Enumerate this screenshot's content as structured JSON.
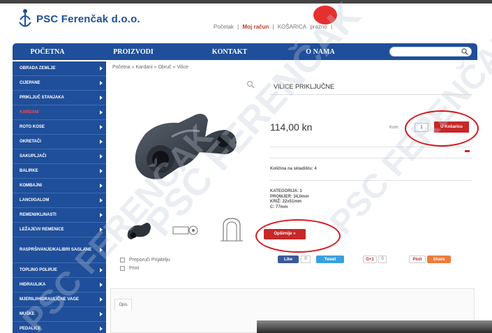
{
  "site": {
    "logo_text": "PSC Ferenčak d.o.o.",
    "top_links": [
      "Početak",
      "Moj račun",
      "KOŠARICA",
      "prazno"
    ],
    "separator": "|"
  },
  "nav": {
    "items": [
      "POČETNA",
      "PROIZVODI",
      "KONTAKT",
      "O NAMA"
    ],
    "search_placeholder": ""
  },
  "sidebar": {
    "items": [
      {
        "label": "OBRADA ZEMLJE",
        "active": false
      },
      {
        "label": "CIJEPANE",
        "active": false
      },
      {
        "label": "PRIKLJUČ STANJAKA",
        "active": false
      },
      {
        "label": "KARDANI",
        "active": true
      },
      {
        "label": "ROTO KOSE",
        "active": false
      },
      {
        "label": "OKRETAČI",
        "active": false
      },
      {
        "label": "SAKUPLJAČI",
        "active": false
      },
      {
        "label": "BALIRKE",
        "active": false
      },
      {
        "label": "KOMBAJNI",
        "active": false
      },
      {
        "label": "LANCI/GALOM",
        "active": false
      },
      {
        "label": "REMENI/KLINASTI",
        "active": false
      },
      {
        "label": "LEŽAJEVI/ REMENICE",
        "active": false
      },
      {
        "label": "RASPRŠIVANJE/KALIBRI SAGLANE",
        "active": false,
        "tall": true
      },
      {
        "label": "TOPLINO POLIRJE",
        "active": false
      },
      {
        "label": "HIDRAULIKA",
        "active": false
      },
      {
        "label": "MJERILI/HIDRAULIČNE VAGE",
        "active": false
      },
      {
        "label": "MUŠKE",
        "active": false
      },
      {
        "label": "PEDALICE",
        "active": false
      }
    ]
  },
  "breadcrumb": [
    "Početna",
    "Kardani",
    "Obruč",
    "Vilice"
  ],
  "breadcrumb_separator": "»",
  "product": {
    "title": "VILICE PRIKLJUČNE",
    "price": "114,00 kn",
    "quantity_label": "Kom:",
    "quantity_value": "1",
    "add_to_cart": "U Košaricu",
    "stock": "Količina na skladištu: 4",
    "specs": [
      "KATEGORIJA: 1",
      "PROMJER: 34,0mm",
      "KRIŽ: 22x51mm",
      "C: 77mm"
    ],
    "description_button": "Opširnije »"
  },
  "social": {
    "like": "Like",
    "like_count": "0",
    "tweet": "Tweet",
    "gplus": "G+1",
    "gplus_count": "0",
    "pinit": "Pinit",
    "share": "Share"
  },
  "options": {
    "opt1": "Preporuči Prijatelju",
    "opt2": "Print"
  },
  "tabs": [
    "Opis"
  ],
  "watermark": "PSC FERENČAK",
  "colors": {
    "brand_blue": "#1f4f9a",
    "accent_red": "#c62828",
    "annotation_red": "#d6171c"
  }
}
